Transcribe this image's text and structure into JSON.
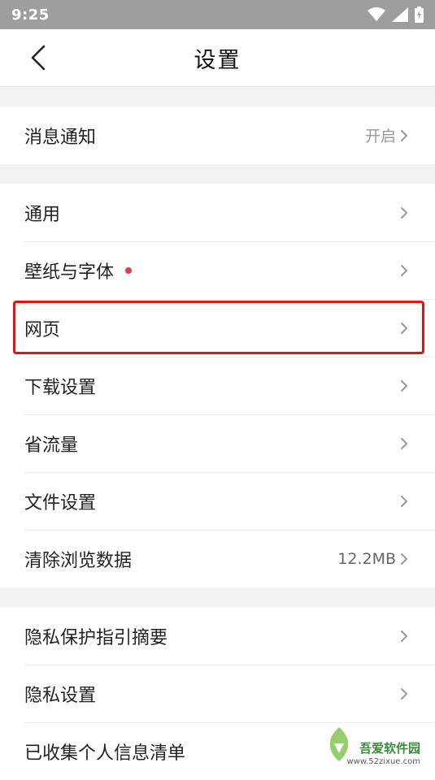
{
  "status": {
    "time": "9:25"
  },
  "header": {
    "title": "设置"
  },
  "groups": [
    {
      "items": [
        {
          "label": "消息通知",
          "value": "开启"
        }
      ]
    },
    {
      "items": [
        {
          "label": "通用",
          "value": ""
        },
        {
          "label": "壁纸与字体",
          "value": ""
        },
        {
          "label": "网页",
          "value": ""
        },
        {
          "label": "下载设置",
          "value": ""
        },
        {
          "label": "省流量",
          "value": ""
        },
        {
          "label": "文件设置",
          "value": ""
        },
        {
          "label": "清除浏览数据",
          "value": "12.2MB"
        }
      ]
    },
    {
      "items": [
        {
          "label": "隐私保护指引摘要",
          "value": ""
        },
        {
          "label": "隐私设置",
          "value": ""
        },
        {
          "label": "已收集个人信息清单",
          "value": ""
        }
      ]
    }
  ],
  "watermark": {
    "text": "吾爱软件园",
    "url": "www.52zixue.com"
  },
  "colors": {
    "highlight": "#e01414",
    "badge": "#ef3b3b",
    "statusbar": "#9e9e9e"
  },
  "icons": [
    "wifi-icon",
    "signal-icon",
    "battery-icon",
    "back-arrow-icon",
    "chevron-right-icon",
    "watermark-logo"
  ]
}
